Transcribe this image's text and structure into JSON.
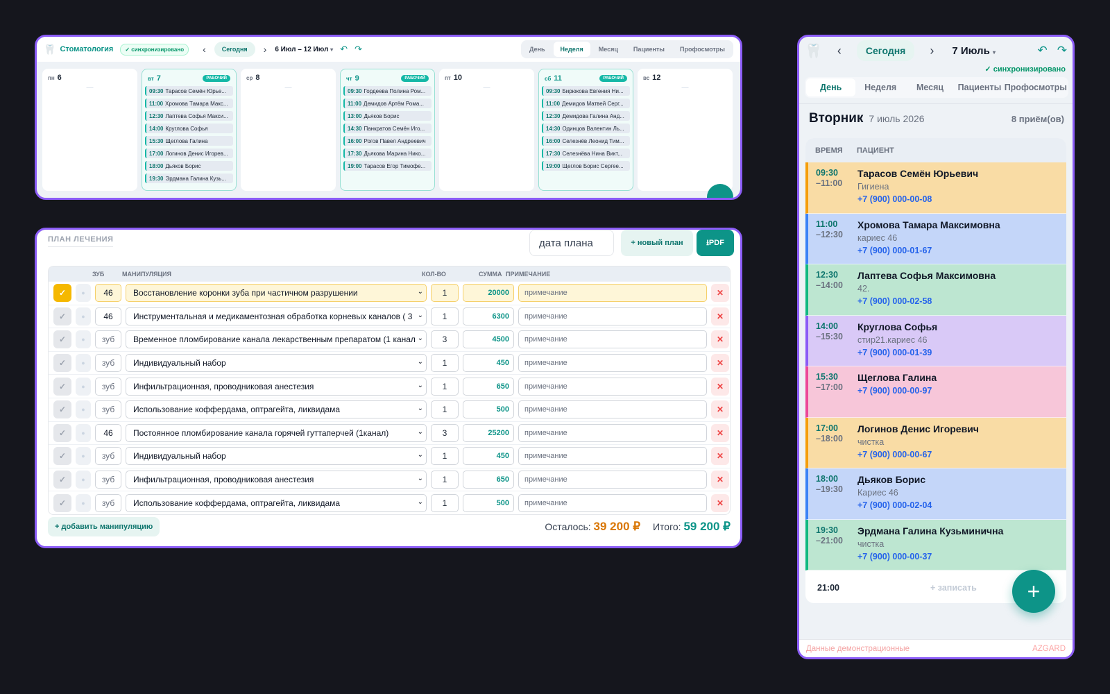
{
  "week": {
    "brand": "Стоматология",
    "sync": "✓ синхронизировано",
    "today": "Сегодня",
    "range": "6 Июл – 12 Июл",
    "view_tabs": [
      "День",
      "Неделя",
      "Месяц",
      "Пациенты",
      "Профосмотры"
    ],
    "active_tab": "Неделя",
    "work_badge": "РАБОЧИЙ",
    "days": [
      {
        "wd": "пн",
        "num": "6",
        "work": false,
        "appts": []
      },
      {
        "wd": "вт",
        "num": "7",
        "work": true,
        "appts": [
          {
            "t": "09:30",
            "n": "Тарасов Семён Юрье..."
          },
          {
            "t": "11:00",
            "n": "Хромова Тамара Макс..."
          },
          {
            "t": "12:30",
            "n": "Лаптева Софья Макси..."
          },
          {
            "t": "14:00",
            "n": "Круглова Софья"
          },
          {
            "t": "15:30",
            "n": "Щеглова Галина"
          },
          {
            "t": "17:00",
            "n": "Логинов Денис Игорев..."
          },
          {
            "t": "18:00",
            "n": "Дьяков Борис"
          },
          {
            "t": "19:30",
            "n": "Эрдмана Галина Кузь..."
          }
        ]
      },
      {
        "wd": "ср",
        "num": "8",
        "work": false,
        "appts": []
      },
      {
        "wd": "чт",
        "num": "9",
        "work": true,
        "appts": [
          {
            "t": "09:30",
            "n": "Гордеева Полина Ром..."
          },
          {
            "t": "11:00",
            "n": "Демидов Артём Рома..."
          },
          {
            "t": "13:00",
            "n": "Дьяков Борис"
          },
          {
            "t": "14:30",
            "n": "Панкратов Семён Иго..."
          },
          {
            "t": "16:00",
            "n": "Рогов Павел Андреевич"
          },
          {
            "t": "17:30",
            "n": "Дьякова Марина Нико..."
          },
          {
            "t": "19:00",
            "n": "Тарасов Егор Тимофе..."
          }
        ]
      },
      {
        "wd": "пт",
        "num": "10",
        "work": false,
        "appts": []
      },
      {
        "wd": "сб",
        "num": "11",
        "work": true,
        "appts": [
          {
            "t": "09:30",
            "n": "Бирюкова Евгения Ни..."
          },
          {
            "t": "11:00",
            "n": "Демидов Матвей Серг..."
          },
          {
            "t": "12:30",
            "n": "Демидова Галина Анд..."
          },
          {
            "t": "14:30",
            "n": "Одинцов Валентин Ль..."
          },
          {
            "t": "16:00",
            "n": "Селезнёв Леонид Тим..."
          },
          {
            "t": "17:30",
            "n": "Селезнёва Нина Викт..."
          },
          {
            "t": "19:00",
            "n": "Щеглов Борис Сергее..."
          }
        ]
      },
      {
        "wd": "вс",
        "num": "12",
        "work": false,
        "appts": []
      }
    ]
  },
  "plan": {
    "title": "ПЛАН ЛЕЧЕНИЯ",
    "date_placeholder": "дата плана",
    "new_plan": "+ новый план",
    "pdf": "⭳PDF",
    "columns": {
      "tooth": "ЗУБ",
      "proc": "МАНИПУЛЯЦИЯ",
      "qty": "КОЛ-ВО",
      "sum": "СУММА",
      "note": "ПРИМЕЧАНИЕ"
    },
    "tooth_placeholder": "зуб",
    "note_placeholder": "примечание",
    "rows": [
      {
        "checked": true,
        "tooth": "46",
        "proc": "Восстановление коронки зуба при частичном разрушении",
        "qty": "1",
        "sum": "20000"
      },
      {
        "checked": false,
        "tooth": "46",
        "proc": "Инструментальная и медикаментозная обработка корневых каналов ( 3",
        "qty": "1",
        "sum": "6300"
      },
      {
        "checked": false,
        "tooth": "",
        "proc": "Временное пломбирование канала лекарственным препаратом (1 канал",
        "qty": "3",
        "sum": "4500"
      },
      {
        "checked": false,
        "tooth": "",
        "proc": "Индивидуальный набор",
        "qty": "1",
        "sum": "450"
      },
      {
        "checked": false,
        "tooth": "",
        "proc": "Инфильтрационная, проводниковая анестезия",
        "qty": "1",
        "sum": "650"
      },
      {
        "checked": false,
        "tooth": "",
        "proc": "Использование коффердама, оптрагейта, ликвидама",
        "qty": "1",
        "sum": "500"
      },
      {
        "checked": false,
        "tooth": "46",
        "proc": "Постоянное пломбирование канала горячей гуттаперчей (1канал)",
        "qty": "3",
        "sum": "25200"
      },
      {
        "checked": false,
        "tooth": "",
        "proc": "Индивидуальный набор",
        "qty": "1",
        "sum": "450"
      },
      {
        "checked": false,
        "tooth": "",
        "proc": "Инфильтрационная, проводниковая анестезия",
        "qty": "1",
        "sum": "650"
      },
      {
        "checked": false,
        "tooth": "",
        "proc": "Использование коффердама, оптрагейта, ликвидама",
        "qty": "1",
        "sum": "500"
      }
    ],
    "add_label": "+ добавить манипуляцию",
    "remaining_label": "Осталось:",
    "remaining": "39 200 ₽",
    "total_label": "Итого:",
    "total": "59 200 ₽"
  },
  "day": {
    "today": "Сегодня",
    "date": "7 Июль",
    "sync": "✓ синхронизировано",
    "tabs": [
      "День",
      "Неделя",
      "Месяц",
      "Пациенты",
      "Профосмотры"
    ],
    "active_tab": "День",
    "weekday": "Вторник",
    "full_date": "7 июль 2026",
    "count": "8 приём(ов)",
    "col_time": "ВРЕМЯ",
    "col_patient": "ПАЦИЕНТ",
    "appointments": [
      {
        "start": "09:30",
        "end": "–11:00",
        "name": "Тарасов Семён Юрьевич",
        "note": "Гигиена",
        "phone": "+7 (900) 000-00-08",
        "bg": "#f9dca5",
        "border": "#f59e0b"
      },
      {
        "start": "11:00",
        "end": "–12:30",
        "name": "Хромова Тамара Максимовна",
        "note": "кариес 46",
        "phone": "+7 (900) 000-01-67",
        "bg": "#c4d6f9",
        "border": "#3b82f6"
      },
      {
        "start": "12:30",
        "end": "–14:00",
        "name": "Лаптева Софья Максимовна",
        "note": "42.",
        "phone": "+7 (900) 000-02-58",
        "bg": "#bde6d1",
        "border": "#10b981"
      },
      {
        "start": "14:00",
        "end": "–15:30",
        "name": "Круглова Софья",
        "note": "стир21.кариес 46",
        "phone": "+7 (900) 000-01-39",
        "bg": "#d9c9f7",
        "border": "#8b5cf6"
      },
      {
        "start": "15:30",
        "end": "–17:00",
        "name": "Щеглова Галина",
        "note": "",
        "phone": "+7 (900) 000-00-97",
        "bg": "#f7c6d9",
        "border": "#ec4899"
      },
      {
        "start": "17:00",
        "end": "–18:00",
        "name": "Логинов Денис Игоревич",
        "note": "чистка",
        "phone": "+7 (900) 000-00-67",
        "bg": "#f9dca5",
        "border": "#f59e0b"
      },
      {
        "start": "18:00",
        "end": "–19:30",
        "name": "Дьяков Борис",
        "note": "Кариес 46",
        "phone": "+7 (900) 000-02-04",
        "bg": "#c4d6f9",
        "border": "#3b82f6"
      },
      {
        "start": "19:30",
        "end": "–21:00",
        "name": "Эрдмана Галина Кузьминична",
        "note": "чистка",
        "phone": "+7 (900) 000-00-37",
        "bg": "#bde6d1",
        "border": "#10b981"
      }
    ],
    "end_time": "21:00",
    "add_label": "+ записать",
    "demo": "Данные демонстрационные",
    "watermark": "AZGARD"
  },
  "colors": {
    "accent": "#0d9488",
    "frame": "#8b5cf6",
    "remaining": "#d97706"
  }
}
